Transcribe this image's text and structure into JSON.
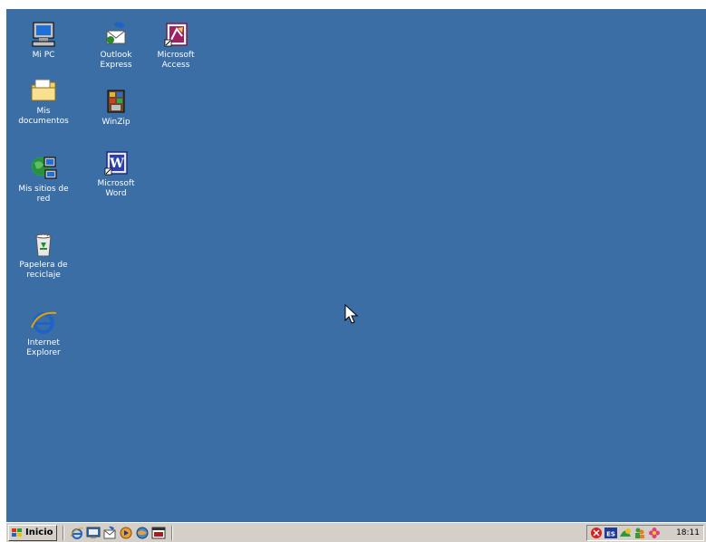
{
  "desktop": {
    "background_color": "#3a6ea5",
    "icons": [
      {
        "label": "Mi PC",
        "icon": "my-computer-icon"
      },
      {
        "label": "Mis\ndocumentos",
        "icon": "my-documents-folder-icon"
      },
      {
        "label": "Mis sitios de\nred",
        "icon": "network-places-icon"
      },
      {
        "label": "Papelera de\nreciclaje",
        "icon": "recycle-bin-icon"
      },
      {
        "label": "Internet\nExplorer",
        "icon": "internet-explorer-icon"
      },
      {
        "label": "Outlook\nExpress",
        "icon": "outlook-express-icon"
      },
      {
        "label": "WinZip",
        "icon": "winzip-icon"
      },
      {
        "label": "Microsoft\nWord",
        "icon": "microsoft-word-icon"
      },
      {
        "label": "Microsoft\nAccess",
        "icon": "microsoft-access-icon"
      }
    ]
  },
  "taskbar": {
    "start_label": "Inicio",
    "quick_launch": [
      "internet-explorer-icon",
      "show-desktop-icon",
      "outlook-express-icon",
      "media-player-icon",
      "browser-icon",
      "window-icon"
    ],
    "tray_icons": [
      "red-alert-icon",
      "language-es-icon",
      "network-icon",
      "people-icon",
      "flower-icon"
    ],
    "clock": "18:11"
  }
}
